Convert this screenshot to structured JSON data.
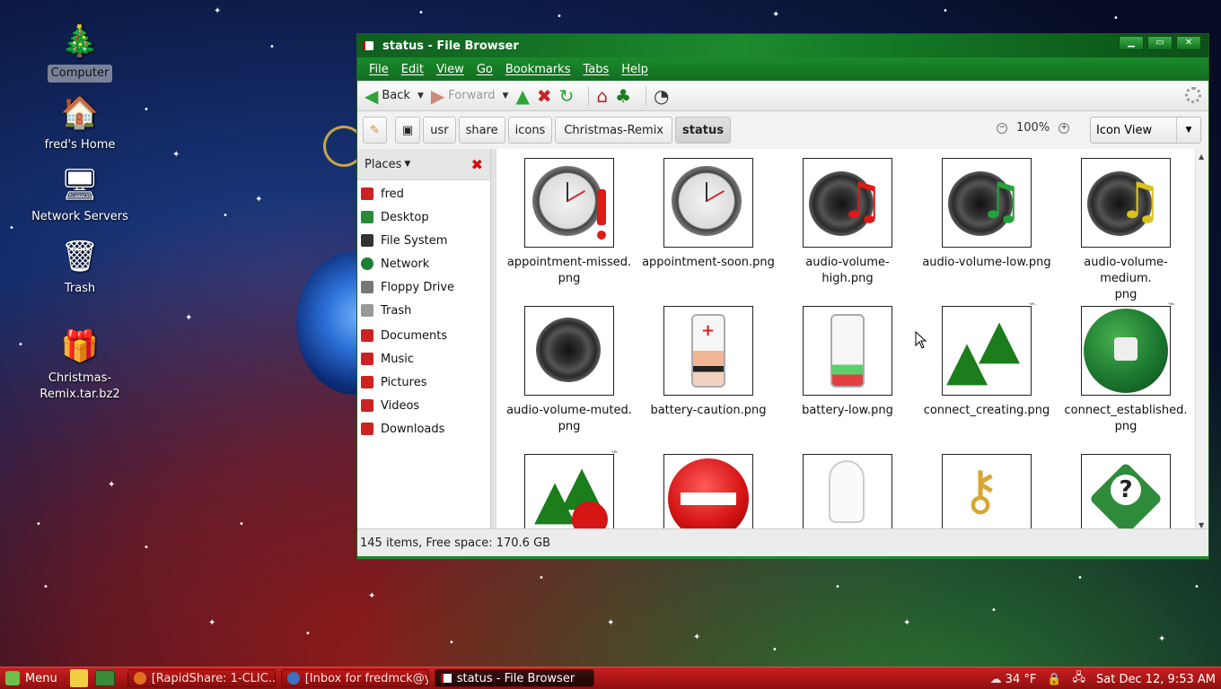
{
  "desktop": {
    "icons": [
      {
        "label": "Computer",
        "icon": "computer-icon"
      },
      {
        "label": "fred's Home",
        "icon": "home-icon"
      },
      {
        "label": "Network Servers",
        "icon": "network-servers-icon"
      },
      {
        "label": "Trash",
        "icon": "trash-icon"
      },
      {
        "label": "Christmas-Remix.tar.bz2",
        "icon": "gift-icon"
      }
    ]
  },
  "window": {
    "title": "status - File Browser",
    "controls": [
      "minimize",
      "maximize",
      "close"
    ]
  },
  "menubar": {
    "items": [
      "File",
      "Edit",
      "View",
      "Go",
      "Bookmarks",
      "Tabs",
      "Help"
    ]
  },
  "toolbar": {
    "back_label": "Back",
    "forward_label": "Forward",
    "icons": [
      "back-arrow-icon",
      "forward-arrow-icon",
      "up-icon",
      "stop-icon",
      "reload-icon",
      "home-icon",
      "computer-icon",
      "search-icon"
    ]
  },
  "location": {
    "crumbs": [
      "usr",
      "share",
      "icons",
      "Christmas-Remix",
      "status"
    ],
    "zoom": "100%",
    "view": "Icon View"
  },
  "sidebar": {
    "header": "Places",
    "items": [
      {
        "label": "fred",
        "icon": "home-icon"
      },
      {
        "label": "Desktop",
        "icon": "desktop-icon"
      },
      {
        "label": "File System",
        "icon": "drive-icon"
      },
      {
        "label": "Network",
        "icon": "network-icon"
      },
      {
        "label": "Floppy Drive",
        "icon": "floppy-icon"
      },
      {
        "label": "Trash",
        "icon": "trash-icon"
      },
      {
        "label": "Documents",
        "icon": "folder-icon"
      },
      {
        "label": "Music",
        "icon": "folder-icon"
      },
      {
        "label": "Pictures",
        "icon": "folder-icon"
      },
      {
        "label": "Videos",
        "icon": "folder-icon"
      },
      {
        "label": "Downloads",
        "icon": "folder-icon"
      }
    ]
  },
  "files": [
    {
      "name": "appointment-missed.png",
      "line1": "appointment-missed.",
      "line2": "png"
    },
    {
      "name": "appointment-soon.png",
      "line1": "appointment-soon.png",
      "line2": ""
    },
    {
      "name": "audio-volume-high.png",
      "line1": "audio-volume-high.png",
      "line2": ""
    },
    {
      "name": "audio-volume-low.png",
      "line1": "audio-volume-low.png",
      "line2": ""
    },
    {
      "name": "audio-volume-medium.png",
      "line1": "audio-volume-medium.",
      "line2": "png"
    },
    {
      "name": "audio-volume-muted.png",
      "line1": "audio-volume-muted.",
      "line2": "png"
    },
    {
      "name": "battery-caution.png",
      "line1": "battery-caution.png",
      "line2": ""
    },
    {
      "name": "battery-low.png",
      "line1": "battery-low.png",
      "line2": ""
    },
    {
      "name": "connect_creating.png",
      "line1": "connect_creating.png",
      "line2": ""
    },
    {
      "name": "connect_established.png",
      "line1": "connect_established.",
      "line2": "png"
    }
  ],
  "status": {
    "text": "145 items, Free space: 170.6 GB"
  },
  "taskbar": {
    "menu_label": "Menu",
    "tasks": [
      {
        "label": "[RapidShare: 1-CLIC...",
        "icon": "firefox-icon"
      },
      {
        "label": "[Inbox for fredmck@y...",
        "icon": "thunderbird-icon"
      },
      {
        "label": "status - File Browser",
        "icon": "window-icon"
      }
    ],
    "weather": "34 °F",
    "clock": "Sat Dec 12,  9:53 AM"
  },
  "colors": {
    "accent_green": "#1d8a2d",
    "taskbar_red": "#b61818"
  }
}
